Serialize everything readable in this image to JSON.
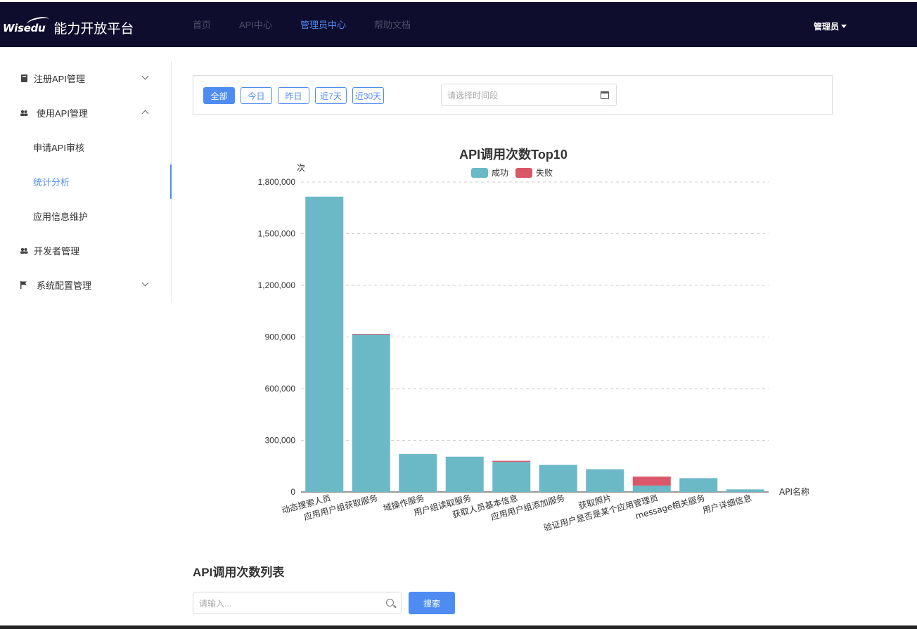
{
  "header": {
    "logo_text": "Wisedu",
    "site_title": "能力开放平台",
    "nav": [
      "首页",
      "API中心",
      "管理员中心",
      "帮助文档"
    ],
    "user": "管理员"
  },
  "sidebar": {
    "items": [
      {
        "label": "注册API管理"
      },
      {
        "label": "使用API管理"
      },
      {
        "label": "申请API审核"
      },
      {
        "label": "统计分析"
      },
      {
        "label": "应用信息维护"
      },
      {
        "label": "开发者管理"
      },
      {
        "label": "系统配置管理"
      }
    ]
  },
  "filter": {
    "buttons": [
      "全部",
      "今日",
      "昨日",
      "近7天",
      "近30天"
    ],
    "date_placeholder": "请选择时间段"
  },
  "chart_data": {
    "type": "bar",
    "title": "API调用次数Top10",
    "ylabel": "次",
    "xlabel": "API名称",
    "ylim": [
      0,
      1800000
    ],
    "yticks": [
      0,
      300000,
      600000,
      900000,
      1200000,
      1500000,
      1800000
    ],
    "ytick_labels": [
      "0",
      "300,000",
      "600,000",
      "900,000",
      "1,200,000",
      "1,500,000",
      "1,800,000"
    ],
    "legend_position": "top-center",
    "grid": true,
    "categories": [
      "动态搜索人员",
      "应用用户组获取服务",
      "域操作服务",
      "用户组读取服务",
      "获取人员基本信息",
      "应用用户组添加服务",
      "获取照片",
      "验证用户是否是某个应用管理员",
      "message相关服务",
      "用户详细信息"
    ],
    "series": [
      {
        "name": "成功",
        "color": "#6bb8c6",
        "values": [
          1715000,
          915000,
          220000,
          205000,
          175000,
          157000,
          132000,
          37000,
          80000,
          15000
        ]
      },
      {
        "name": "失败",
        "color": "#d95769",
        "values": [
          0,
          3000,
          0,
          0,
          6000,
          0,
          0,
          52000,
          0,
          0
        ]
      }
    ]
  },
  "list": {
    "title": "API调用次数列表",
    "search_placeholder": "请输入...",
    "search_button": "搜索"
  }
}
